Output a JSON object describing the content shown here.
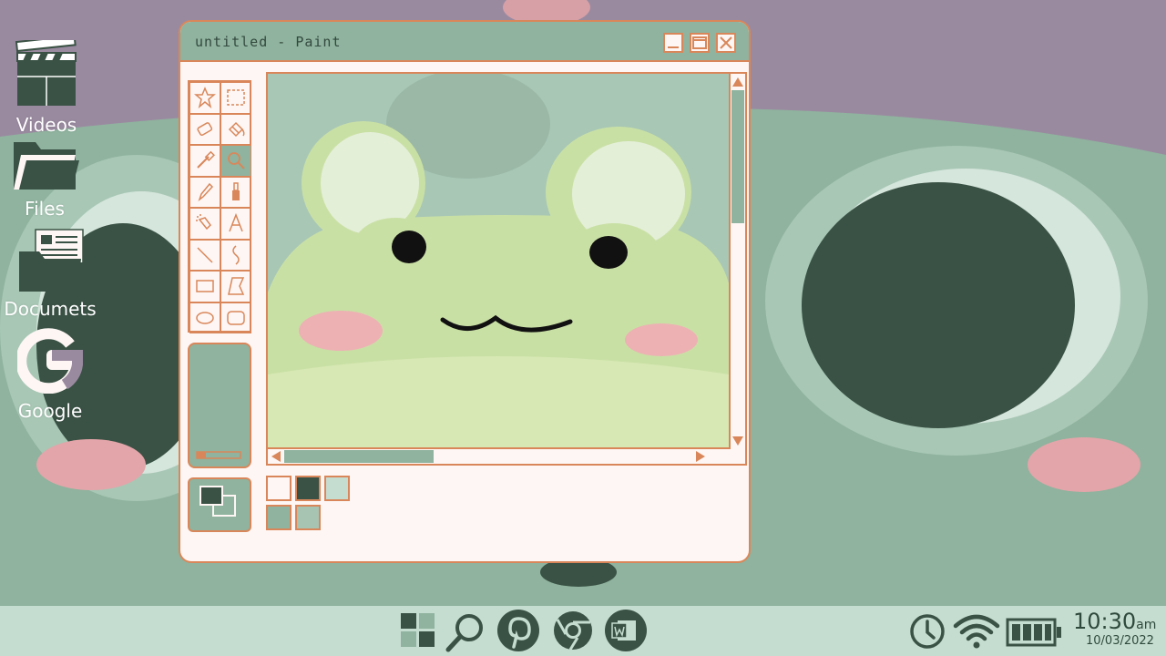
{
  "colors": {
    "wallpaper_sky": "#9a8aa0",
    "wallpaper_frog": "#8fb39e",
    "accent_orange": "#d9875a",
    "window_bg": "#fdf6f4",
    "dark_green": "#3a5245",
    "taskbar_bg": "#c5ddd1"
  },
  "desktop": {
    "icons": [
      {
        "label": "Videos",
        "icon": "clapperboard-icon"
      },
      {
        "label": "Files",
        "icon": "folder-icon"
      },
      {
        "label": "Documets",
        "icon": "documents-folder-icon"
      },
      {
        "label": "Google",
        "icon": "google-icon"
      }
    ]
  },
  "window": {
    "title": "untitled - Paint",
    "controls": [
      "minimize-icon",
      "maximize-icon",
      "close-icon"
    ],
    "tools": [
      "free-form-select-icon",
      "rect-select-icon",
      "eraser-icon",
      "fill-bucket-icon",
      "color-picker-icon",
      "magnifier-icon",
      "pencil-icon",
      "brush-icon",
      "airbrush-icon",
      "text-icon",
      "line-icon",
      "curve-icon",
      "rectangle-icon",
      "polygon-icon",
      "ellipse-icon",
      "rounded-rect-icon"
    ],
    "selected_tool": "magnifier-icon",
    "palette": [
      "#fdf6f4",
      "#3a5245",
      "#c5ddd1",
      "#8fb39e",
      "#a7c4b2"
    ]
  },
  "taskbar": {
    "icons": [
      "start-grid-icon",
      "search-icon",
      "pinterest-icon",
      "chrome-icon",
      "word-icon"
    ],
    "tray": [
      "clock-icon",
      "wifi-icon",
      "battery-icon"
    ],
    "time": "10:30",
    "ampm": "am",
    "date": "10/03/2022"
  }
}
